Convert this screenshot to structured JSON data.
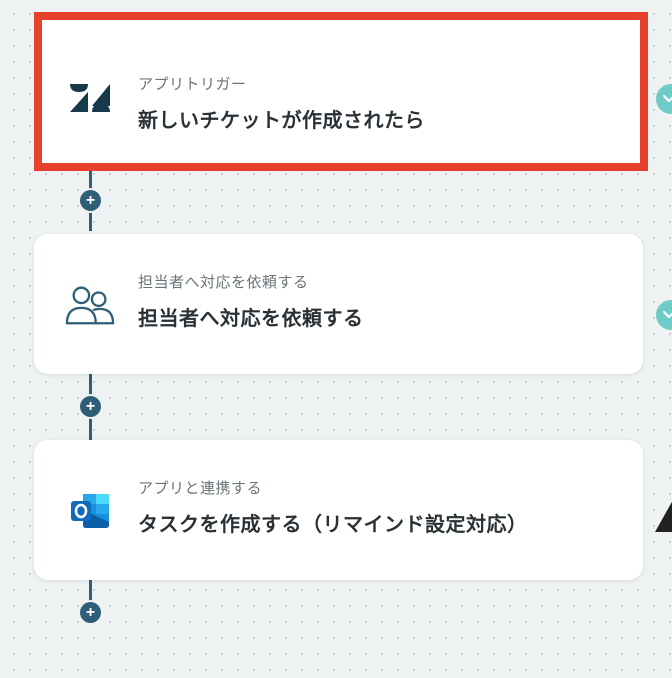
{
  "flow": {
    "steps": [
      {
        "sub_label": "アプリトリガー",
        "title": "新しいチケットが作成されたら",
        "icon": "zendesk-icon",
        "selected": true
      },
      {
        "sub_label": "担当者へ対応を依頼する",
        "title": "担当者へ対応を依頼する",
        "icon": "people-icon",
        "selected": false
      },
      {
        "sub_label": "アプリと連携する",
        "title": "タスクを作成する（リマインド設定対応）",
        "icon": "outlook-icon",
        "selected": false
      }
    ],
    "add_glyph": "+"
  },
  "colors": {
    "selection_border": "#e8412b",
    "connector": "#2f5f78",
    "toggle": "#6fcbc8",
    "background": "#eef2f3"
  }
}
